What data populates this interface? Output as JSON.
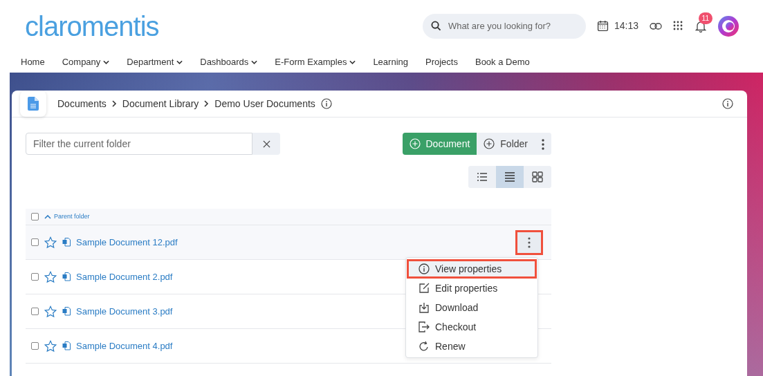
{
  "header": {
    "logo": "claromentis",
    "search": {
      "placeholder": "What are you looking for?"
    },
    "time": "14:13",
    "notifications": {
      "count": "11"
    }
  },
  "nav": [
    {
      "label": "Home",
      "dropdown": false
    },
    {
      "label": "Company",
      "dropdown": true
    },
    {
      "label": "Department",
      "dropdown": true
    },
    {
      "label": "Dashboards",
      "dropdown": true
    },
    {
      "label": "E-Form Examples",
      "dropdown": true
    },
    {
      "label": "Learning",
      "dropdown": false
    },
    {
      "label": "Projects",
      "dropdown": false
    },
    {
      "label": "Book a Demo",
      "dropdown": false
    }
  ],
  "breadcrumb": [
    "Documents",
    "Document Library",
    "Demo User Documents"
  ],
  "filter": {
    "placeholder": "Filter the current folder"
  },
  "actions": [
    {
      "label": "Document",
      "kind": "primary"
    },
    {
      "label": "Folder",
      "kind": "secondary"
    }
  ],
  "view_modes": [
    {
      "kind": "list",
      "selected": false
    },
    {
      "kind": "lines",
      "selected": true
    },
    {
      "kind": "grid",
      "selected": false
    }
  ],
  "parent_folder": {
    "label": "Parent folder",
    "checked": false
  },
  "rows": [
    {
      "name": "Sample Document 12.pdf",
      "checked": false,
      "starred": false,
      "hovered": true,
      "highlighted": true
    },
    {
      "name": "Sample Document 2.pdf",
      "checked": false,
      "starred": false,
      "hovered": false,
      "highlighted": false
    },
    {
      "name": "Sample Document 3.pdf",
      "checked": false,
      "starred": false,
      "hovered": false,
      "highlighted": false
    },
    {
      "name": "Sample Document 4.pdf",
      "checked": false,
      "starred": false,
      "hovered": false,
      "highlighted": false
    }
  ],
  "menu": [
    {
      "label": "View properties",
      "kind": "info",
      "selected": true,
      "highlighted": true
    },
    {
      "label": "Edit properties",
      "kind": "edit",
      "selected": false,
      "highlighted": false
    },
    {
      "label": "Download",
      "kind": "download",
      "selected": false,
      "highlighted": false
    },
    {
      "label": "Checkout",
      "kind": "checkout",
      "selected": false,
      "highlighted": false
    },
    {
      "label": "Renew",
      "kind": "renew",
      "selected": false,
      "highlighted": false
    }
  ]
}
